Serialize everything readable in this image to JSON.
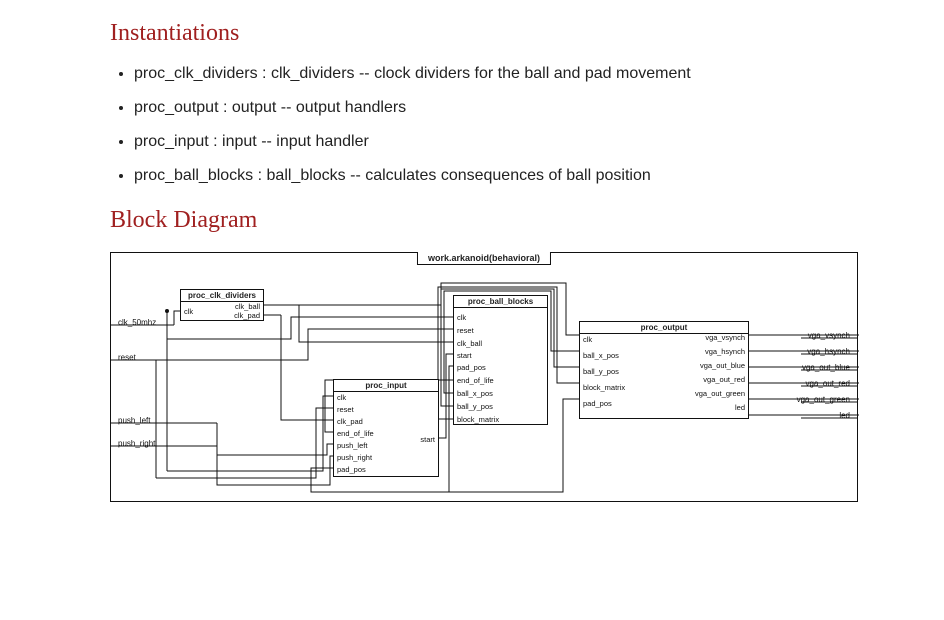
{
  "headings": {
    "instantiations": "Instantiations",
    "block_diagram": "Block Diagram"
  },
  "instantiations": [
    "proc_clk_dividers : clk_dividers -- clock dividers for the ball and pad movement",
    "proc_output : output -- output handlers",
    "proc_input : input -- input handler",
    "proc_ball_blocks : ball_blocks -- calculates consequences of ball position"
  ],
  "diagram": {
    "title": "work.arkanoid(behavioral)",
    "external_inputs": [
      "clk_50mhz",
      "reset",
      "push_left",
      "push_right"
    ],
    "external_outputs": [
      "vga_vsynch",
      "vga_hsynch",
      "vga_out_blue",
      "vga_out_red",
      "vga_out_green",
      "led"
    ],
    "blocks": {
      "clk_dividers": {
        "name": "proc_clk_dividers",
        "in": [
          "clk"
        ],
        "out": [
          "clk_ball",
          "clk_pad"
        ]
      },
      "ball_blocks": {
        "name": "proc_ball_blocks",
        "in": [
          "clk",
          "reset",
          "clk_ball",
          "start",
          "pad_pos",
          "end_of_life",
          "ball_x_pos",
          "ball_y_pos",
          "block_matrix"
        ]
      },
      "input": {
        "name": "proc_input",
        "in": [
          "clk",
          "reset",
          "clk_pad",
          "end_of_life",
          "push_left",
          "push_right",
          "pad_pos"
        ],
        "out": [
          "start"
        ]
      },
      "output": {
        "name": "proc_output",
        "in": [
          "clk",
          "ball_x_pos",
          "ball_y_pos",
          "block_matrix",
          "pad_pos"
        ],
        "out": [
          "vga_vsynch",
          "vga_hsynch",
          "vga_out_blue",
          "vga_out_red",
          "vga_out_green",
          "led"
        ]
      }
    }
  }
}
